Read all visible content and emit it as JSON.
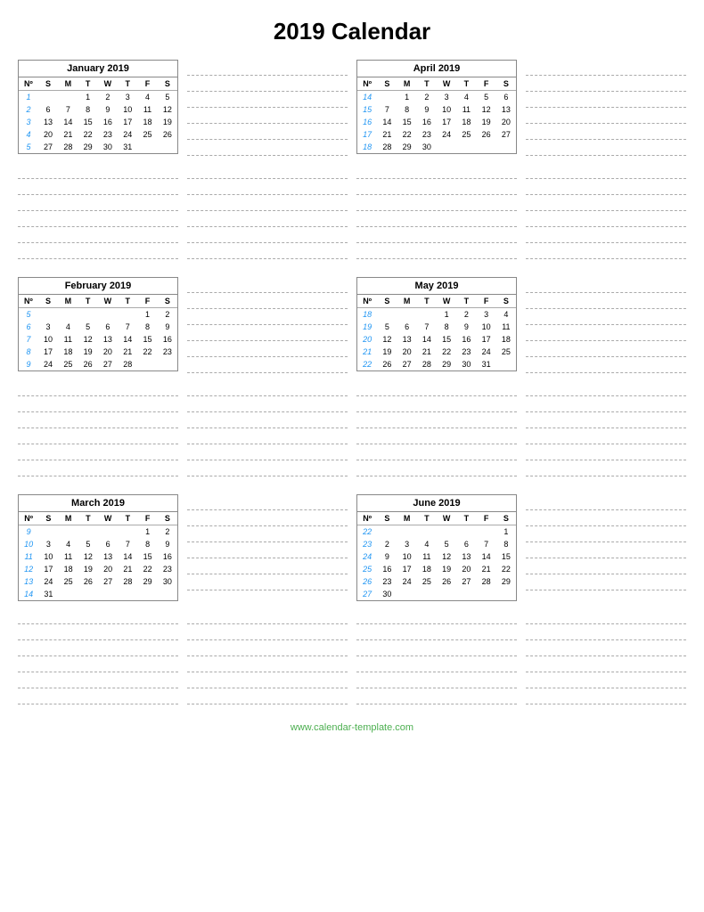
{
  "title": "2019 Calendar",
  "footer": "www.calendar-template.com",
  "months": [
    {
      "name": "January 2019",
      "headers": [
        "Nº",
        "S",
        "M",
        "T",
        "W",
        "T",
        "F",
        "S"
      ],
      "weeks": [
        [
          "1",
          "",
          "",
          "1",
          "2",
          "3",
          "4",
          "5"
        ],
        [
          "2",
          "6",
          "7",
          "8",
          "9",
          "10",
          "11",
          "12"
        ],
        [
          "3",
          "13",
          "14",
          "15",
          "16",
          "17",
          "18",
          "19"
        ],
        [
          "4",
          "20",
          "21",
          "22",
          "23",
          "24",
          "25",
          "26"
        ],
        [
          "5",
          "27",
          "28",
          "29",
          "30",
          "31",
          "",
          ""
        ]
      ]
    },
    {
      "name": "April 2019",
      "headers": [
        "Nº",
        "S",
        "M",
        "T",
        "W",
        "T",
        "F",
        "S"
      ],
      "weeks": [
        [
          "14",
          "",
          "1",
          "2",
          "3",
          "4",
          "5",
          "6"
        ],
        [
          "15",
          "7",
          "8",
          "9",
          "10",
          "11",
          "12",
          "13"
        ],
        [
          "16",
          "14",
          "15",
          "16",
          "17",
          "18",
          "19",
          "20"
        ],
        [
          "17",
          "21",
          "22",
          "23",
          "24",
          "25",
          "26",
          "27"
        ],
        [
          "18",
          "28",
          "29",
          "30",
          "",
          "",
          "",
          ""
        ]
      ]
    },
    {
      "name": "February 2019",
      "headers": [
        "Nº",
        "S",
        "M",
        "T",
        "W",
        "T",
        "F",
        "S"
      ],
      "weeks": [
        [
          "5",
          "",
          "",
          "",
          "",
          "",
          "1",
          "2"
        ],
        [
          "6",
          "3",
          "4",
          "5",
          "6",
          "7",
          "8",
          "9"
        ],
        [
          "7",
          "10",
          "11",
          "12",
          "13",
          "14",
          "15",
          "16"
        ],
        [
          "8",
          "17",
          "18",
          "19",
          "20",
          "21",
          "22",
          "23"
        ],
        [
          "9",
          "24",
          "25",
          "26",
          "27",
          "28",
          "",
          ""
        ]
      ]
    },
    {
      "name": "May 2019",
      "headers": [
        "Nº",
        "S",
        "M",
        "T",
        "W",
        "T",
        "F",
        "S"
      ],
      "weeks": [
        [
          "18",
          "",
          "",
          "",
          "1",
          "2",
          "3",
          "4"
        ],
        [
          "19",
          "5",
          "6",
          "7",
          "8",
          "9",
          "10",
          "11"
        ],
        [
          "20",
          "12",
          "13",
          "14",
          "15",
          "16",
          "17",
          "18"
        ],
        [
          "21",
          "19",
          "20",
          "21",
          "22",
          "23",
          "24",
          "25"
        ],
        [
          "22",
          "26",
          "27",
          "28",
          "29",
          "30",
          "31",
          ""
        ]
      ]
    },
    {
      "name": "March 2019",
      "headers": [
        "Nº",
        "S",
        "M",
        "T",
        "W",
        "T",
        "F",
        "S"
      ],
      "weeks": [
        [
          "9",
          "",
          "",
          "",
          "",
          "",
          "1",
          "2"
        ],
        [
          "10",
          "3",
          "4",
          "5",
          "6",
          "7",
          "8",
          "9"
        ],
        [
          "11",
          "10",
          "11",
          "12",
          "13",
          "14",
          "15",
          "16"
        ],
        [
          "12",
          "17",
          "18",
          "19",
          "20",
          "21",
          "22",
          "23"
        ],
        [
          "13",
          "24",
          "25",
          "26",
          "27",
          "28",
          "29",
          "30"
        ],
        [
          "14",
          "31",
          "",
          "",
          "",
          "",
          "",
          ""
        ]
      ]
    },
    {
      "name": "June 2019",
      "headers": [
        "Nº",
        "S",
        "M",
        "T",
        "W",
        "T",
        "F",
        "S"
      ],
      "weeks": [
        [
          "22",
          "",
          "",
          "",
          "",
          "",
          "",
          "1"
        ],
        [
          "23",
          "2",
          "3",
          "4",
          "5",
          "6",
          "7",
          "8"
        ],
        [
          "24",
          "9",
          "10",
          "11",
          "12",
          "13",
          "14",
          "15"
        ],
        [
          "25",
          "16",
          "17",
          "18",
          "19",
          "20",
          "21",
          "22"
        ],
        [
          "26",
          "23",
          "24",
          "25",
          "26",
          "27",
          "28",
          "29"
        ],
        [
          "27",
          "30",
          "",
          "",
          "",
          "",
          "",
          ""
        ]
      ]
    }
  ],
  "notes_count": 6
}
